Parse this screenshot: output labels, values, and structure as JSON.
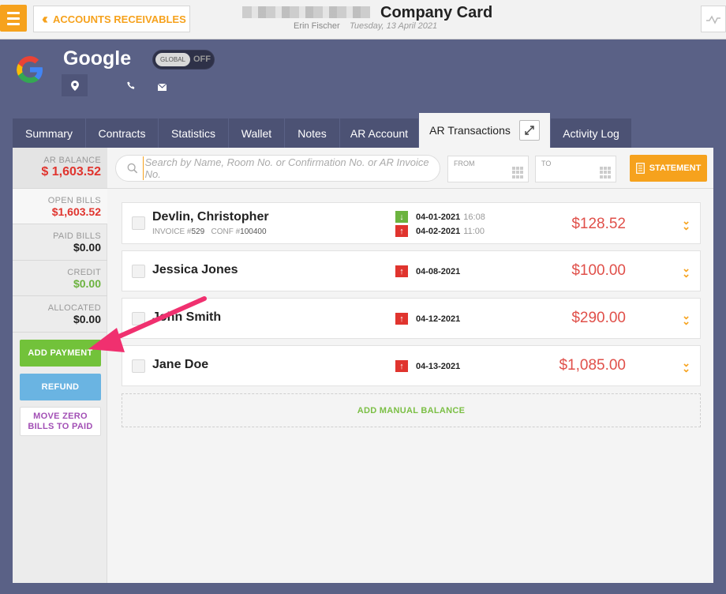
{
  "topbar": {
    "back_label": "ACCOUNTS RECEIVABLES",
    "title": "Company Card",
    "user": "Erin Fischer",
    "date": "Tuesday, 13 April 2021"
  },
  "customer": {
    "name": "Google",
    "global_label": "GLOBAL",
    "global_state": "OFF"
  },
  "tabs": [
    {
      "label": "Summary"
    },
    {
      "label": "Contracts"
    },
    {
      "label": "Statistics"
    },
    {
      "label": "Wallet"
    },
    {
      "label": "Notes"
    },
    {
      "label": "AR Account"
    },
    {
      "label": "AR Transactions"
    },
    {
      "label": "Activity Log"
    }
  ],
  "sidebar": {
    "ar_balance_label": "AR BALANCE",
    "ar_balance_value": "$ 1,603.52",
    "open_bills_label": "OPEN BILLS",
    "open_bills_value": "$1,603.52",
    "paid_bills_label": "PAID BILLS",
    "paid_bills_value": "$0.00",
    "credit_label": "CREDIT",
    "credit_value": "$0.00",
    "allocated_label": "ALLOCATED",
    "allocated_value": "$0.00",
    "add_payment": "ADD PAYMENT",
    "refund": "REFUND",
    "move_zero_line1": "MOVE ZERO",
    "move_zero_line2": "BILLS TO PAID"
  },
  "toolbar": {
    "search_placeholder": "Search by Name, Room No. or Confirmation No. or AR Invoice No.",
    "from_label": "FROM",
    "to_label": "TO",
    "statement_label": "STATEMENT"
  },
  "transactions": [
    {
      "name": "Devlin, Christopher",
      "invoice_label": "INVOICE #",
      "invoice": "529",
      "conf_label": "CONF #",
      "conf": "100400",
      "date1": "04-01-2021",
      "time1": "16:08",
      "date2": "04-02-2021",
      "time2": "11:00",
      "amount": "$128.52"
    },
    {
      "name": "Jessica Jones",
      "date": "04-08-2021",
      "amount": "$100.00"
    },
    {
      "name": "John Smith",
      "date": "04-12-2021",
      "amount": "$290.00"
    },
    {
      "name": "Jane Doe",
      "date": "04-13-2021",
      "amount": "$1,085.00"
    }
  ],
  "manual_balance_label": "ADD MANUAL BALANCE",
  "colors": {
    "accent": "#f6a21d",
    "navy": "#5a6186",
    "red": "#e0504a",
    "green": "#6cb33f",
    "annotation": "#f0306f"
  }
}
